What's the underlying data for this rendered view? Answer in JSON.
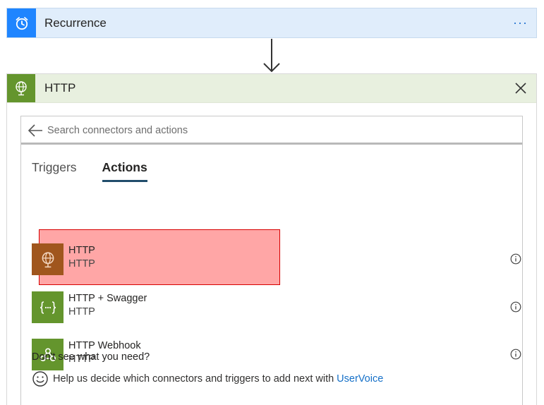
{
  "recurrence": {
    "title": "Recurrence",
    "icon": "alarm-clock-icon",
    "menu_label": "···",
    "accent": "#1f85ff"
  },
  "http_card": {
    "title": "HTTP",
    "icon": "globe-icon",
    "accent": "#64952d"
  },
  "search": {
    "placeholder": "Search connectors and actions",
    "value": ""
  },
  "tabs": [
    {
      "label": "Triggers",
      "active": false
    },
    {
      "label": "Actions",
      "active": true
    }
  ],
  "actions": [
    {
      "name": "HTTP",
      "subtitle": "HTTP",
      "icon": "globe-icon",
      "highlighted": true,
      "color": "#a0561d"
    },
    {
      "name": "HTTP + Swagger",
      "subtitle": "HTTP",
      "icon": "braces-dots-icon",
      "highlighted": false,
      "color": "#64952d"
    },
    {
      "name": "HTTP Webhook",
      "subtitle": "HTTP",
      "icon": "webhook-icon",
      "highlighted": false,
      "color": "#64952d"
    }
  ],
  "help": {
    "title": "Don't see what you need?",
    "text": "Help us decide which connectors and triggers to add next with",
    "link": "UserVoice"
  }
}
